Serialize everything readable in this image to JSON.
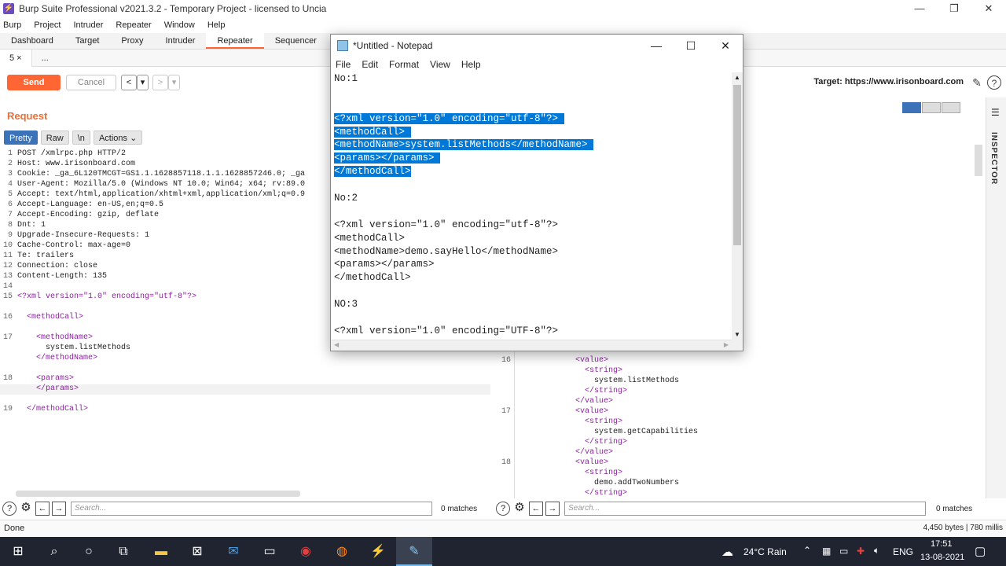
{
  "burp": {
    "window_title": "Burp Suite Professional v2021.3.2 - Temporary Project - licensed to Uncia",
    "win_controls": {
      "minimize": "—",
      "maximize": "❐",
      "close": "✕"
    },
    "menu": [
      "Burp",
      "Project",
      "Intruder",
      "Repeater",
      "Window",
      "Help"
    ],
    "tabs": [
      "Dashboard",
      "Target",
      "Proxy",
      "Intruder",
      "Repeater",
      "Sequencer"
    ],
    "active_tab": "Repeater",
    "subtabs": [
      "5 ×",
      "..."
    ],
    "send_label": "Send",
    "cancel_label": "Cancel",
    "back_label": "<",
    "forward_label": ">",
    "dropdown_glyph": "▾",
    "target_label": "Target: https://www.irisonboard.com",
    "request_title": "Request",
    "request_toolbar": [
      "Pretty",
      "Raw",
      "\\n",
      "Actions ⌄"
    ],
    "request_lines": [
      {
        "n": "1",
        "text": "POST /xmlrpc.php HTTP/2"
      },
      {
        "n": "2",
        "text": "Host: www.irisonboard.com"
      },
      {
        "n": "3",
        "text": "Cookie: _ga_6L120TMCGT=GS1.1.1628857118.1.1.1628857246.0; _ga"
      },
      {
        "n": "4",
        "text": "User-Agent: Mozilla/5.0 (Windows NT 10.0; Win64; x64; rv:89.0"
      },
      {
        "n": "5",
        "text": "Accept: text/html,application/xhtml+xml,application/xml;q=0.9"
      },
      {
        "n": "6",
        "text": "Accept-Language: en-US,en;q=0.5"
      },
      {
        "n": "7",
        "text": "Accept-Encoding: gzip, deflate"
      },
      {
        "n": "8",
        "text": "Dnt: 1"
      },
      {
        "n": "9",
        "text": "Upgrade-Insecure-Requests: 1"
      },
      {
        "n": "10",
        "text": "Cache-Control: max-age=0"
      },
      {
        "n": "11",
        "text": "Te: trailers"
      },
      {
        "n": "12",
        "text": "Connection: close"
      },
      {
        "n": "13",
        "text": "Content-Length: 135"
      },
      {
        "n": "14",
        "text": ""
      },
      {
        "n": "15",
        "text": "<?xml version=\"1.0\" encoding=\"utf-8\"?>"
      },
      {
        "n": "16",
        "text": "  <methodCall>"
      },
      {
        "n": "17",
        "text": "    <methodName>"
      },
      {
        "n": "",
        "text": "      system.listMethods"
      },
      {
        "n": "",
        "text": "    </methodName>"
      },
      {
        "n": "18",
        "text": "    <params>"
      },
      {
        "n": "",
        "text": "    </params>"
      },
      {
        "n": "19",
        "text": "  </methodCall>"
      }
    ],
    "response_lines": [
      {
        "n": "",
        "text": "</value>"
      },
      {
        "n": "16",
        "text": "<value>"
      },
      {
        "n": "",
        "text": "  <string>"
      },
      {
        "n": "",
        "text": "    system.listMethods"
      },
      {
        "n": "",
        "text": "  </string>"
      },
      {
        "n": "",
        "text": "</value>"
      },
      {
        "n": "17",
        "text": "<value>"
      },
      {
        "n": "",
        "text": "  <string>"
      },
      {
        "n": "",
        "text": "    system.getCapabilities"
      },
      {
        "n": "",
        "text": "  </string>"
      },
      {
        "n": "",
        "text": "</value>"
      },
      {
        "n": "18",
        "text": "<value>"
      },
      {
        "n": "",
        "text": "  <string>"
      },
      {
        "n": "",
        "text": "    demo.addTwoNumbers"
      },
      {
        "n": "",
        "text": "  </string>"
      }
    ],
    "inspector_label": "INSPECTOR",
    "search_placeholder": "Search...",
    "matches_left": "0 matches",
    "matches_right": "0 matches",
    "status_left": "Done",
    "status_right": "4,450 bytes | 780 millis"
  },
  "notepad": {
    "title": "*Untitled - Notepad",
    "controls": {
      "minimize": "—",
      "maximize": "☐",
      "close": "✕"
    },
    "menu": [
      "File",
      "Edit",
      "Format",
      "View",
      "Help"
    ],
    "lines": [
      {
        "text": "No:1",
        "sel": false
      },
      {
        "text": "",
        "sel": false
      },
      {
        "text": "",
        "sel": false
      },
      {
        "text": "<?xml version=\"1.0\" encoding=\"utf-8\"?> ",
        "sel": true
      },
      {
        "text": "<methodCall> ",
        "sel": true
      },
      {
        "text": "<methodName>system.listMethods</methodName> ",
        "sel": true
      },
      {
        "text": "<params></params> ",
        "sel": true
      },
      {
        "text": "</methodCall>",
        "sel": true
      },
      {
        "text": "",
        "sel": false
      },
      {
        "text": "No:2",
        "sel": false
      },
      {
        "text": "",
        "sel": false
      },
      {
        "text": "<?xml version=\"1.0\" encoding=\"utf-8\"?>",
        "sel": false
      },
      {
        "text": "<methodCall>",
        "sel": false
      },
      {
        "text": "<methodName>demo.sayHello</methodName>",
        "sel": false
      },
      {
        "text": "<params></params>",
        "sel": false
      },
      {
        "text": "</methodCall>",
        "sel": false
      },
      {
        "text": "",
        "sel": false
      },
      {
        "text": "NO:3",
        "sel": false
      },
      {
        "text": "",
        "sel": false
      },
      {
        "text": "<?xml version=\"1.0\" encoding=\"UTF-8\"?>",
        "sel": false
      }
    ]
  },
  "taskbar": {
    "weather": "24°C  Rain",
    "language": "ENG",
    "time": "17:51",
    "date": "13-08-2021"
  }
}
